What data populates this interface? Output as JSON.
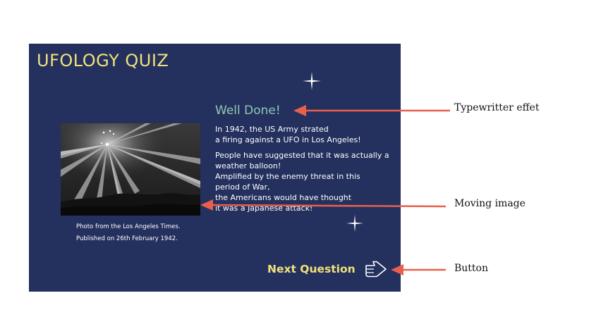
{
  "app": {
    "title": "UFOLOGY QUIZ"
  },
  "photo": {
    "caption_line1": "Photo from the Los Angeles Times.",
    "caption_line2": "Published on 26th February 1942."
  },
  "result": {
    "heading": "Well Done!",
    "paragraph1": [
      "In 1942, the US Army strated",
      "a firing against a UFO in Los Angeles!"
    ],
    "paragraph2": [
      "People have suggested that it was actually a",
      "weather balloon!",
      "Amplified by the enemy threat in this",
      "period of War,",
      "the Americans would have thought",
      "it was a Japanese attack!"
    ]
  },
  "navigation": {
    "next_label": "Next Question",
    "next_icon": "hand-pointer-right-icon"
  },
  "annotations": {
    "typewriter": "Typewritter effet",
    "moving_image": "Moving image",
    "button": "Button"
  },
  "colors": {
    "panel_background": "#24305e",
    "title_yellow": "#f0e27a",
    "heading_green": "#8fcbb0",
    "annotation_arrow": "#e8604c"
  }
}
